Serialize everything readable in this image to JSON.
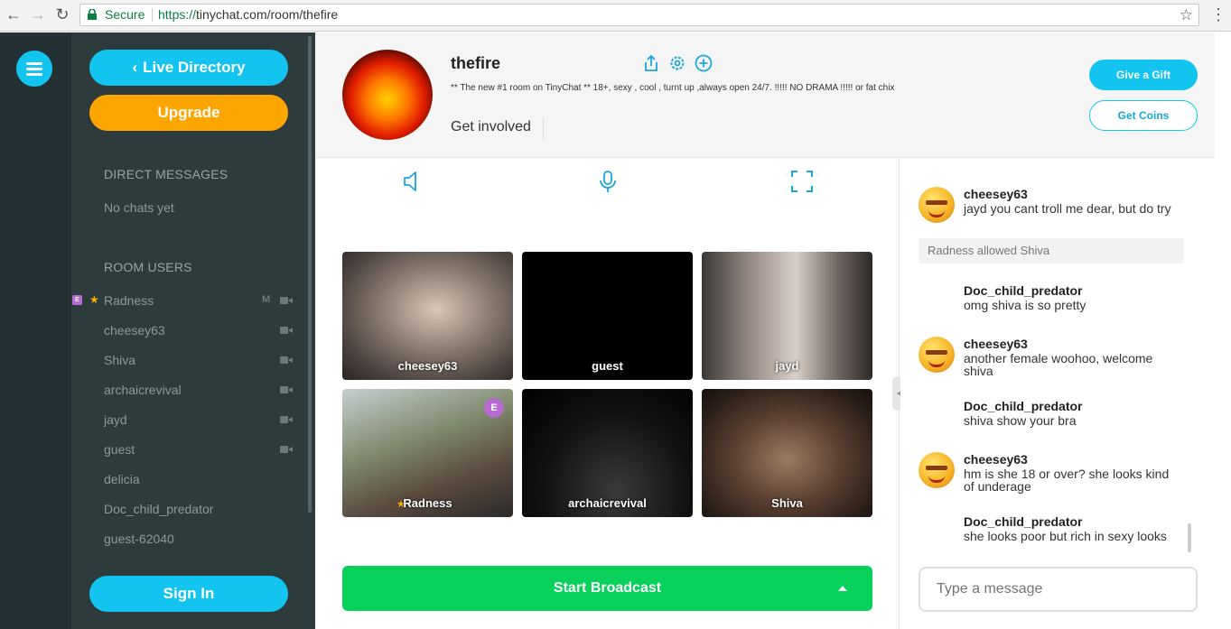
{
  "browser": {
    "secure_label": "Secure",
    "url_scheme": "https://",
    "url_rest": "tinychat.com/room/thefire"
  },
  "sidebar": {
    "live_directory": "Live Directory",
    "upgrade": "Upgrade",
    "direct_messages_heading": "DIRECT MESSAGES",
    "no_chats": "No chats yet",
    "room_users_heading": "ROOM USERS",
    "users": [
      {
        "name": "Radness",
        "badge": "E",
        "star": true,
        "mod": "M",
        "cam": true
      },
      {
        "name": "cheesey63",
        "cam": true
      },
      {
        "name": "Shiva",
        "cam": true
      },
      {
        "name": "archaicrevival",
        "cam": true
      },
      {
        "name": "jayd",
        "cam": true
      },
      {
        "name": "guest",
        "cam": true
      },
      {
        "name": "delicia",
        "cam": false
      },
      {
        "name": "Doc_child_predator",
        "cam": false
      },
      {
        "name": "guest-62040",
        "cam": false
      }
    ],
    "sign_in": "Sign In"
  },
  "room": {
    "name": "thefire",
    "description": "** The new #1 room on TinyChat ** 18+, sexy , cool , turnt up ,always open 24/7. !!!!! NO DRAMA !!!!! or fat chix",
    "get_involved": "Get involved",
    "give_gift": "Give a Gift",
    "get_coins": "Get Coins"
  },
  "videos": [
    {
      "name": "cheesey63"
    },
    {
      "name": "guest"
    },
    {
      "name": "jayd"
    },
    {
      "name": "Radness",
      "badge": "E",
      "star": true
    },
    {
      "name": "archaicrevival"
    },
    {
      "name": "Shiva"
    }
  ],
  "broadcast_label": "Start Broadcast",
  "chat": {
    "messages": [
      {
        "author": "cheesey63",
        "text": "jayd you cant troll me dear, but do try",
        "emoji": true
      },
      {
        "author": "Doc_child_predator",
        "text": "omg shiva is so pretty",
        "emoji": false
      },
      {
        "author": "cheesey63",
        "text": "another female woohoo, welcome shiva",
        "emoji": true
      },
      {
        "author": "Doc_child_predator",
        "text": "shiva show your bra",
        "emoji": false
      },
      {
        "author": "cheesey63",
        "text": "hm is she 18 or over? she looks kind of underage",
        "emoji": true
      },
      {
        "author": "Doc_child_predator",
        "text": "she looks poor but rich in sexy looks",
        "emoji": false
      }
    ],
    "system_message": "Radness allowed Shiva",
    "input_placeholder": "Type a message"
  },
  "colors": {
    "accent": "#14c4f0",
    "upgrade": "#ffa500",
    "broadcast": "#07d15a",
    "sidebar_bg": "#2e3b3d"
  }
}
